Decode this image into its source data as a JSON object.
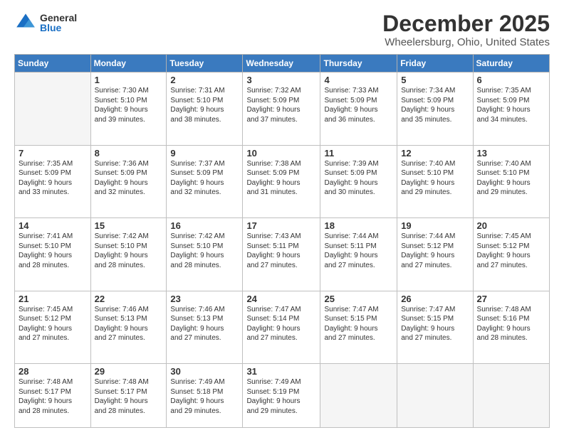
{
  "logo": {
    "general": "General",
    "blue": "Blue"
  },
  "title": "December 2025",
  "subtitle": "Wheelersburg, Ohio, United States",
  "days_of_week": [
    "Sunday",
    "Monday",
    "Tuesday",
    "Wednesday",
    "Thursday",
    "Friday",
    "Saturday"
  ],
  "weeks": [
    [
      {
        "day": "",
        "info": ""
      },
      {
        "day": "1",
        "info": "Sunrise: 7:30 AM\nSunset: 5:10 PM\nDaylight: 9 hours\nand 39 minutes."
      },
      {
        "day": "2",
        "info": "Sunrise: 7:31 AM\nSunset: 5:10 PM\nDaylight: 9 hours\nand 38 minutes."
      },
      {
        "day": "3",
        "info": "Sunrise: 7:32 AM\nSunset: 5:09 PM\nDaylight: 9 hours\nand 37 minutes."
      },
      {
        "day": "4",
        "info": "Sunrise: 7:33 AM\nSunset: 5:09 PM\nDaylight: 9 hours\nand 36 minutes."
      },
      {
        "day": "5",
        "info": "Sunrise: 7:34 AM\nSunset: 5:09 PM\nDaylight: 9 hours\nand 35 minutes."
      },
      {
        "day": "6",
        "info": "Sunrise: 7:35 AM\nSunset: 5:09 PM\nDaylight: 9 hours\nand 34 minutes."
      }
    ],
    [
      {
        "day": "7",
        "info": "Sunrise: 7:35 AM\nSunset: 5:09 PM\nDaylight: 9 hours\nand 33 minutes."
      },
      {
        "day": "8",
        "info": "Sunrise: 7:36 AM\nSunset: 5:09 PM\nDaylight: 9 hours\nand 32 minutes."
      },
      {
        "day": "9",
        "info": "Sunrise: 7:37 AM\nSunset: 5:09 PM\nDaylight: 9 hours\nand 32 minutes."
      },
      {
        "day": "10",
        "info": "Sunrise: 7:38 AM\nSunset: 5:09 PM\nDaylight: 9 hours\nand 31 minutes."
      },
      {
        "day": "11",
        "info": "Sunrise: 7:39 AM\nSunset: 5:09 PM\nDaylight: 9 hours\nand 30 minutes."
      },
      {
        "day": "12",
        "info": "Sunrise: 7:40 AM\nSunset: 5:10 PM\nDaylight: 9 hours\nand 29 minutes."
      },
      {
        "day": "13",
        "info": "Sunrise: 7:40 AM\nSunset: 5:10 PM\nDaylight: 9 hours\nand 29 minutes."
      }
    ],
    [
      {
        "day": "14",
        "info": "Sunrise: 7:41 AM\nSunset: 5:10 PM\nDaylight: 9 hours\nand 28 minutes."
      },
      {
        "day": "15",
        "info": "Sunrise: 7:42 AM\nSunset: 5:10 PM\nDaylight: 9 hours\nand 28 minutes."
      },
      {
        "day": "16",
        "info": "Sunrise: 7:42 AM\nSunset: 5:10 PM\nDaylight: 9 hours\nand 28 minutes."
      },
      {
        "day": "17",
        "info": "Sunrise: 7:43 AM\nSunset: 5:11 PM\nDaylight: 9 hours\nand 27 minutes."
      },
      {
        "day": "18",
        "info": "Sunrise: 7:44 AM\nSunset: 5:11 PM\nDaylight: 9 hours\nand 27 minutes."
      },
      {
        "day": "19",
        "info": "Sunrise: 7:44 AM\nSunset: 5:12 PM\nDaylight: 9 hours\nand 27 minutes."
      },
      {
        "day": "20",
        "info": "Sunrise: 7:45 AM\nSunset: 5:12 PM\nDaylight: 9 hours\nand 27 minutes."
      }
    ],
    [
      {
        "day": "21",
        "info": "Sunrise: 7:45 AM\nSunset: 5:12 PM\nDaylight: 9 hours\nand 27 minutes."
      },
      {
        "day": "22",
        "info": "Sunrise: 7:46 AM\nSunset: 5:13 PM\nDaylight: 9 hours\nand 27 minutes."
      },
      {
        "day": "23",
        "info": "Sunrise: 7:46 AM\nSunset: 5:13 PM\nDaylight: 9 hours\nand 27 minutes."
      },
      {
        "day": "24",
        "info": "Sunrise: 7:47 AM\nSunset: 5:14 PM\nDaylight: 9 hours\nand 27 minutes."
      },
      {
        "day": "25",
        "info": "Sunrise: 7:47 AM\nSunset: 5:15 PM\nDaylight: 9 hours\nand 27 minutes."
      },
      {
        "day": "26",
        "info": "Sunrise: 7:47 AM\nSunset: 5:15 PM\nDaylight: 9 hours\nand 27 minutes."
      },
      {
        "day": "27",
        "info": "Sunrise: 7:48 AM\nSunset: 5:16 PM\nDaylight: 9 hours\nand 28 minutes."
      }
    ],
    [
      {
        "day": "28",
        "info": "Sunrise: 7:48 AM\nSunset: 5:17 PM\nDaylight: 9 hours\nand 28 minutes."
      },
      {
        "day": "29",
        "info": "Sunrise: 7:48 AM\nSunset: 5:17 PM\nDaylight: 9 hours\nand 28 minutes."
      },
      {
        "day": "30",
        "info": "Sunrise: 7:49 AM\nSunset: 5:18 PM\nDaylight: 9 hours\nand 29 minutes."
      },
      {
        "day": "31",
        "info": "Sunrise: 7:49 AM\nSunset: 5:19 PM\nDaylight: 9 hours\nand 29 minutes."
      },
      {
        "day": "",
        "info": ""
      },
      {
        "day": "",
        "info": ""
      },
      {
        "day": "",
        "info": ""
      }
    ]
  ]
}
